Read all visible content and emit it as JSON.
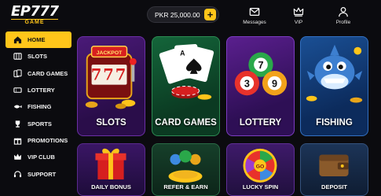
{
  "brand": {
    "name": "EP777",
    "sub": "GAME"
  },
  "balance": {
    "text": "PKR 25,000.00",
    "add_label": "+"
  },
  "topnav": [
    {
      "label": "Messages",
      "icon": "mail-icon"
    },
    {
      "label": "VIP",
      "icon": "crown-icon"
    },
    {
      "label": "Profile",
      "icon": "user-icon"
    }
  ],
  "sidebar": {
    "items": [
      {
        "label": "HOME",
        "icon": "home-icon",
        "active": true
      },
      {
        "label": "SLOTS",
        "icon": "slots-icon"
      },
      {
        "label": "CARD GAMES",
        "icon": "cards-icon"
      },
      {
        "label": "LOTTERY",
        "icon": "lottery-icon"
      },
      {
        "label": "FISHING",
        "icon": "fishing-icon"
      },
      {
        "label": "SPORTS",
        "icon": "trophy-icon"
      },
      {
        "label": "PROMOTIONS",
        "icon": "gift-icon"
      },
      {
        "label": "VIP CLUB",
        "icon": "crown-icon"
      },
      {
        "label": "SUPPORT",
        "icon": "headset-icon"
      }
    ]
  },
  "games": [
    {
      "label": "SLOTS",
      "badge": "JACKPOT",
      "reels": "777"
    },
    {
      "label": "CARD GAMES"
    },
    {
      "label": "LOTTERY",
      "balls": [
        "7",
        "3",
        "9"
      ]
    },
    {
      "label": "FISHING"
    }
  ],
  "features": [
    {
      "label": "DAILY BONUS"
    },
    {
      "label": "REFER & EARN"
    },
    {
      "label": "LUCKY SPIN",
      "wheel_text": "GO"
    },
    {
      "label": "DEPOSIT"
    }
  ],
  "colors": {
    "accent": "#ffc51a",
    "background": "#0b0b0f"
  }
}
